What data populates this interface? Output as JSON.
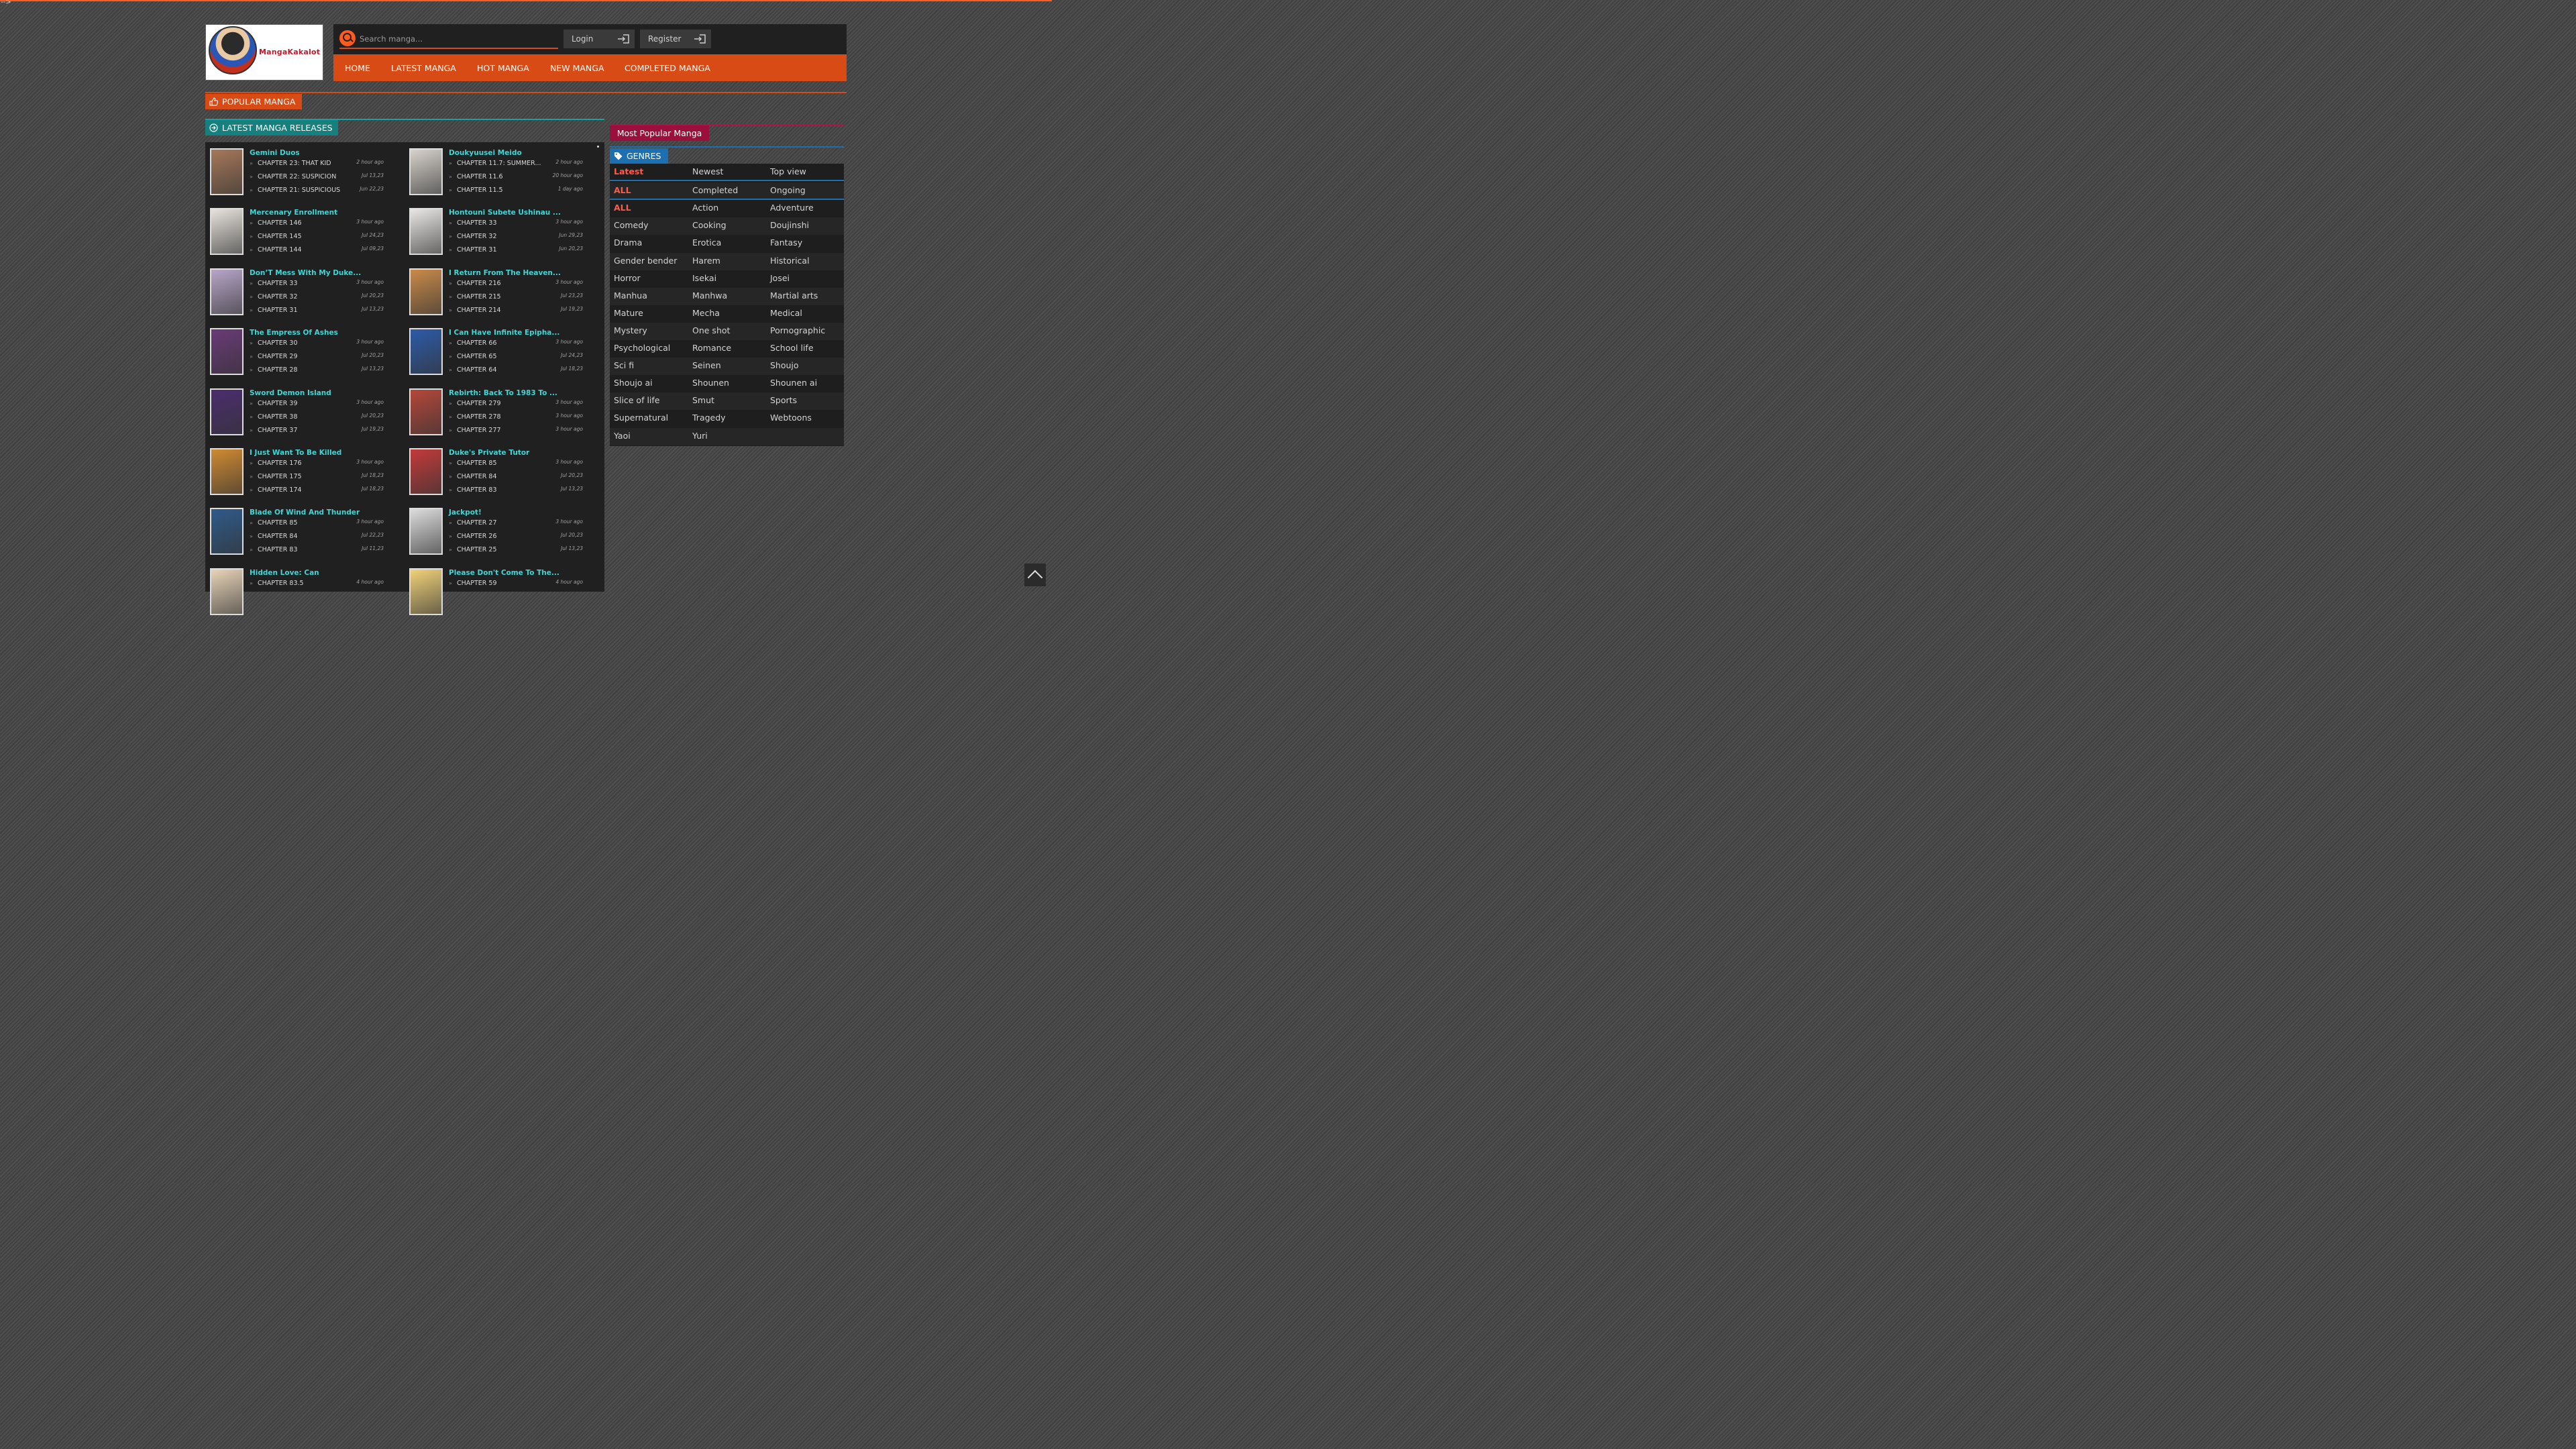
{
  "stray_text": "-->",
  "brand": {
    "logo_text": "MangaKakalot"
  },
  "search": {
    "placeholder": "Search manga..."
  },
  "account": {
    "login": "Login",
    "register": "Register"
  },
  "nav": [
    "HOME",
    "LATEST MANGA",
    "HOT MANGA",
    "NEW MANGA",
    "COMPLETED MANGA"
  ],
  "sections": {
    "popular": "POPULAR MANGA",
    "latest": "LATEST MANGA RELEASES",
    "most_popular": "Most Popular Manga",
    "genres": "GENRES"
  },
  "colors": {
    "accent": "#d94b14",
    "teal": "#16807f",
    "title_cyan": "#3fd6d6",
    "crimson": "#9a0f3c",
    "blue": "#1c6fb0"
  },
  "releases": [
    {
      "title": "Gemini Duos",
      "thumb": "#a7785a",
      "chapters": [
        {
          "name": "CHAPTER 23: THAT KID",
          "time": "2 hour ago"
        },
        {
          "name": "CHAPTER 22: SUSPICION",
          "time": "Jul 13,23"
        },
        {
          "name": "CHAPTER 21: SUSPICIOUS",
          "time": "Jun 22,23"
        }
      ]
    },
    {
      "title": "Doukyuusei Meido",
      "thumb": "#d7d2cc",
      "chapters": [
        {
          "name": "CHAPTER 11.7: SUMMER...",
          "time": "2 hour ago"
        },
        {
          "name": "CHAPTER 11.6",
          "time": "20 hour ago"
        },
        {
          "name": "CHAPTER 11.5",
          "time": "1 day ago"
        }
      ]
    },
    {
      "title": "Mercenary Enrollment",
      "thumb": "#e7e2dc",
      "chapters": [
        {
          "name": "CHAPTER 146",
          "time": "3 hour ago"
        },
        {
          "name": "CHAPTER 145",
          "time": "Jul 24,23"
        },
        {
          "name": "CHAPTER 144",
          "time": "Jul 09,23"
        }
      ]
    },
    {
      "title": "Hontouni Subete Ushinau ...",
      "thumb": "#e9e6e4",
      "chapters": [
        {
          "name": "CHAPTER 33",
          "time": "3 hour ago"
        },
        {
          "name": "CHAPTER 32",
          "time": "Jun 29,23"
        },
        {
          "name": "CHAPTER 31",
          "time": "Jun 20,23"
        }
      ]
    },
    {
      "title": "Don’T Mess With My Duke...",
      "thumb": "#b8a6c8",
      "chapters": [
        {
          "name": "CHAPTER 33",
          "time": "3 hour ago"
        },
        {
          "name": "CHAPTER 32",
          "time": "Jul 20,23"
        },
        {
          "name": "CHAPTER 31",
          "time": "Jul 13,23"
        }
      ]
    },
    {
      "title": "I Return From The Heaven...",
      "thumb": "#c98a4a",
      "chapters": [
        {
          "name": "CHAPTER 216",
          "time": "3 hour ago"
        },
        {
          "name": "CHAPTER 215",
          "time": "Jul 23,23"
        },
        {
          "name": "CHAPTER 214",
          "time": "Jul 19,23"
        }
      ]
    },
    {
      "title": "The Empress Of Ashes",
      "thumb": "#6a3a78",
      "chapters": [
        {
          "name": "CHAPTER 30",
          "time": "3 hour ago"
        },
        {
          "name": "CHAPTER 29",
          "time": "Jul 20,23"
        },
        {
          "name": "CHAPTER 28",
          "time": "Jul 13,23"
        }
      ]
    },
    {
      "title": "I Can Have Infinite Epipha...",
      "thumb": "#2d5aa8",
      "chapters": [
        {
          "name": "CHAPTER 66",
          "time": "3 hour ago"
        },
        {
          "name": "CHAPTER 65",
          "time": "Jul 24,23"
        },
        {
          "name": "CHAPTER 64",
          "time": "Jul 18,23"
        }
      ]
    },
    {
      "title": "Sword Demon Island",
      "thumb": "#4b2d6e",
      "chapters": [
        {
          "name": "CHAPTER 39",
          "time": "3 hour ago"
        },
        {
          "name": "CHAPTER 38",
          "time": "Jul 20,23"
        },
        {
          "name": "CHAPTER 37",
          "time": "Jul 19,23"
        }
      ]
    },
    {
      "title": "Rebirth: Back To 1983 To ...",
      "thumb": "#b5473a",
      "chapters": [
        {
          "name": "CHAPTER 279",
          "time": "3 hour ago"
        },
        {
          "name": "CHAPTER 278",
          "time": "3 hour ago"
        },
        {
          "name": "CHAPTER 277",
          "time": "3 hour ago"
        }
      ]
    },
    {
      "title": "I Just Want To Be Killed",
      "thumb": "#d08a32",
      "chapters": [
        {
          "name": "CHAPTER 176",
          "time": "3 hour ago"
        },
        {
          "name": "CHAPTER 175",
          "time": "Jul 18,23"
        },
        {
          "name": "CHAPTER 174",
          "time": "Jul 18,23"
        }
      ]
    },
    {
      "title": "Duke's Private Tutor",
      "thumb": "#c23a3a",
      "chapters": [
        {
          "name": "CHAPTER 85",
          "time": "3 hour ago"
        },
        {
          "name": "CHAPTER 84",
          "time": "Jul 20,23"
        },
        {
          "name": "CHAPTER 83",
          "time": "Jul 13,23"
        }
      ]
    },
    {
      "title": "Blade Of Wind And Thunder",
      "thumb": "#2f5a8a",
      "chapters": [
        {
          "name": "CHAPTER 85",
          "time": "3 hour ago"
        },
        {
          "name": "CHAPTER 84",
          "time": "Jul 22,23"
        },
        {
          "name": "CHAPTER 83",
          "time": "Jul 11,23"
        }
      ]
    },
    {
      "title": "Jackpot!",
      "thumb": "#dcdcdc",
      "chapters": [
        {
          "name": "CHAPTER 27",
          "time": "3 hour ago"
        },
        {
          "name": "CHAPTER 26",
          "time": "Jul 20,23"
        },
        {
          "name": "CHAPTER 25",
          "time": "Jul 13,23"
        }
      ]
    },
    {
      "title": "Hidden Love: Can",
      "thumb": "#e8d4b8",
      "chapters": [
        {
          "name": "CHAPTER 83.5",
          "time": "4 hour ago"
        }
      ]
    },
    {
      "title": "Please Don't Come To The...",
      "thumb": "#f1d27a",
      "chapters": [
        {
          "name": "CHAPTER 59",
          "time": "4 hour ago"
        }
      ]
    }
  ],
  "genres": {
    "rows": [
      [
        {
          "label": "Latest",
          "hl": true
        },
        {
          "label": "Newest"
        },
        {
          "label": "Top view"
        }
      ],
      [
        {
          "label": "ALL",
          "hl": true
        },
        {
          "label": "Completed"
        },
        {
          "label": "Ongoing"
        }
      ],
      [
        {
          "label": "ALL",
          "hl": true
        },
        {
          "label": "Action"
        },
        {
          "label": "Adventure"
        }
      ],
      [
        {
          "label": "Comedy"
        },
        {
          "label": "Cooking"
        },
        {
          "label": "Doujinshi"
        }
      ],
      [
        {
          "label": "Drama"
        },
        {
          "label": "Erotica"
        },
        {
          "label": "Fantasy"
        }
      ],
      [
        {
          "label": "Gender bender"
        },
        {
          "label": "Harem"
        },
        {
          "label": "Historical"
        }
      ],
      [
        {
          "label": "Horror"
        },
        {
          "label": "Isekai"
        },
        {
          "label": "Josei"
        }
      ],
      [
        {
          "label": "Manhua"
        },
        {
          "label": "Manhwa"
        },
        {
          "label": "Martial arts"
        }
      ],
      [
        {
          "label": "Mature"
        },
        {
          "label": "Mecha"
        },
        {
          "label": "Medical"
        }
      ],
      [
        {
          "label": "Mystery"
        },
        {
          "label": "One shot"
        },
        {
          "label": "Pornographic"
        }
      ],
      [
        {
          "label": "Psychological"
        },
        {
          "label": "Romance"
        },
        {
          "label": "School life"
        }
      ],
      [
        {
          "label": "Sci fi"
        },
        {
          "label": "Seinen"
        },
        {
          "label": "Shoujo"
        }
      ],
      [
        {
          "label": "Shoujo ai"
        },
        {
          "label": "Shounen"
        },
        {
          "label": "Shounen ai"
        }
      ],
      [
        {
          "label": "Slice of life"
        },
        {
          "label": "Smut"
        },
        {
          "label": "Sports"
        }
      ],
      [
        {
          "label": "Supernatural"
        },
        {
          "label": "Tragedy"
        },
        {
          "label": "Webtoons"
        }
      ],
      [
        {
          "label": "Yaoi"
        },
        {
          "label": "Yuri"
        }
      ]
    ]
  }
}
